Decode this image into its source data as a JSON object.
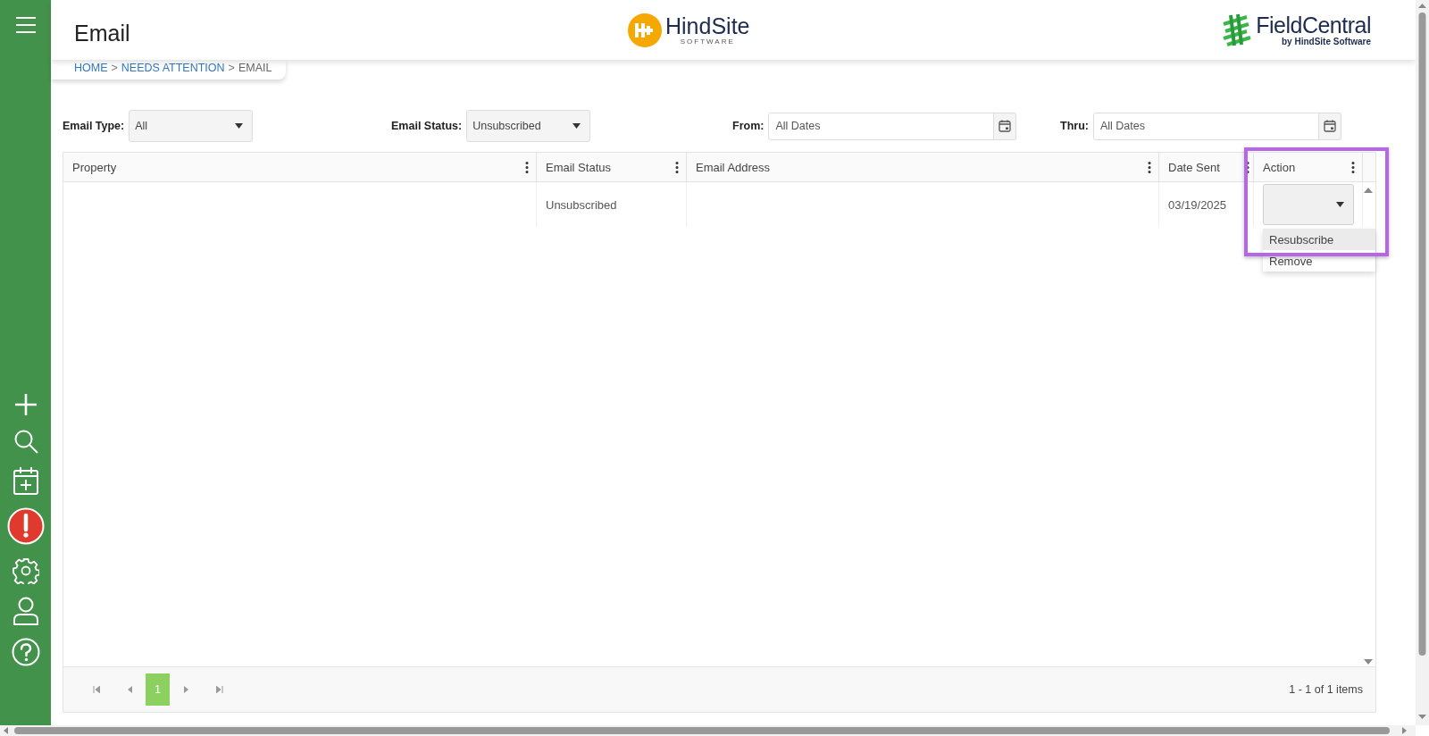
{
  "header": {
    "title": "Email",
    "breadcrumb": [
      {
        "label": "HOME",
        "link": true,
        "separator": ">"
      },
      {
        "label": "NEEDS ATTENTION",
        "link": true,
        "separator": ">"
      },
      {
        "label": "EMAIL",
        "link": false
      }
    ],
    "center_logo": {
      "name": "HindSite",
      "tagline": "SOFTWARE"
    },
    "right_logo": {
      "name": "FieldCentral",
      "tagline": "by HindSite Software"
    }
  },
  "filters": [
    {
      "label": "Email Type:",
      "kind": "select",
      "value": "All"
    },
    {
      "label": "Email Status:",
      "kind": "select",
      "value": "Unsubscribed"
    },
    {
      "label": "From:",
      "kind": "date",
      "value": "All Dates"
    },
    {
      "label": "Thru:",
      "kind": "date",
      "value": "All Dates"
    }
  ],
  "table": {
    "columns": [
      "Property",
      "Email Status",
      "Email Address",
      "Date Sent",
      "Action"
    ],
    "rows": [
      {
        "email_status": "Unsubscribed",
        "date_sent": "03/19/2025",
        "action": {
          "expanded": true,
          "options": [
            {
              "label": "Resubscribe",
              "selected": true
            },
            {
              "label": "Remove",
              "selected": false
            }
          ]
        }
      }
    ]
  },
  "pager": {
    "pages": [
      {
        "label": "1",
        "selected": true
      }
    ],
    "summary": "1 - 1 of 1 items"
  }
}
